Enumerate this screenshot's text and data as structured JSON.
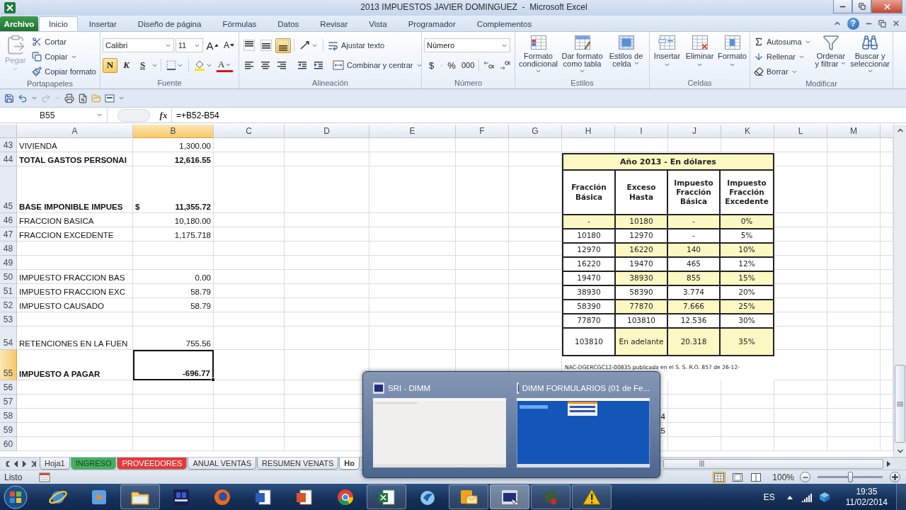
{
  "window": {
    "title": "2013 IMPUESTOS JAVIER DOMINGUEZ  -  Microsoft Excel"
  },
  "ribbon_tabs": [
    {
      "label": "Archivo",
      "kind": "file",
      "selected": false
    },
    {
      "label": "Inicio",
      "kind": "tab",
      "selected": true
    },
    {
      "label": "Insertar",
      "kind": "tab",
      "selected": false
    },
    {
      "label": "Diseño de página",
      "kind": "tab",
      "selected": false
    },
    {
      "label": "Fórmulas",
      "kind": "tab",
      "selected": false
    },
    {
      "label": "Datos",
      "kind": "tab",
      "selected": false
    },
    {
      "label": "Revisar",
      "kind": "tab",
      "selected": false
    },
    {
      "label": "Vista",
      "kind": "tab",
      "selected": false
    },
    {
      "label": "Programador",
      "kind": "tab",
      "selected": false
    },
    {
      "label": "Complementos",
      "kind": "tab",
      "selected": false
    }
  ],
  "help": "?",
  "ribbon": {
    "clipboard": {
      "label": "Portapapeles",
      "paste": {
        "label": "Pegar",
        "disabled": true
      },
      "items": [
        {
          "label": "Cortar",
          "dropdown": false
        },
        {
          "label": "Copiar",
          "dropdown": true
        },
        {
          "label": "Copiar formato",
          "dropdown": false
        }
      ]
    },
    "font": {
      "label": "Fuente",
      "font_name": "Calibri",
      "font_size": "11",
      "grow": "A",
      "shrink": "A",
      "styles": [
        {
          "label": "N",
          "selected": true
        },
        {
          "label": "K",
          "selected": false
        },
        {
          "label": "S",
          "selected": false
        }
      ],
      "color_button": "A"
    },
    "alignment": {
      "label": "Alineación",
      "vertical": [
        {
          "selected": false
        },
        {
          "selected": false
        },
        {
          "selected": true
        }
      ],
      "wrap": "Ajustar texto",
      "merge": "Combinar y centrar"
    },
    "number": {
      "label": "Número",
      "format": "Número",
      "buttons": [
        "$",
        "%",
        "000"
      ]
    },
    "styles": {
      "label": "Estilos",
      "buttons": [
        "Formato condicional",
        "Dar formato como tabla",
        "Estilos de celda"
      ]
    },
    "cells": {
      "label": "Celdas",
      "buttons": [
        "Insertar",
        "Eliminar",
        "Formato"
      ]
    },
    "editing": {
      "label": "Modificar",
      "small": [
        "Autosuma",
        "Rellenar",
        "Borrar"
      ],
      "large": [
        "Ordenar y filtrar",
        "Buscar y seleccionar"
      ]
    }
  },
  "formula_bar": {
    "name_box": "B55",
    "fx": "fx",
    "formula": "=+B52-B54"
  },
  "columns": [
    {
      "label": "A",
      "selected": false
    },
    {
      "label": "B",
      "selected": true
    },
    {
      "label": "C",
      "selected": false
    },
    {
      "label": "D",
      "selected": false
    },
    {
      "label": "E",
      "selected": false
    },
    {
      "label": "F",
      "selected": false
    },
    {
      "label": "G",
      "selected": false
    },
    {
      "label": "H",
      "selected": false
    },
    {
      "label": "I",
      "selected": false
    },
    {
      "label": "J",
      "selected": false
    },
    {
      "label": "K",
      "selected": false
    },
    {
      "label": "L",
      "selected": false
    },
    {
      "label": "M",
      "selected": false
    }
  ],
  "rows": [
    {
      "number": "43",
      "kind": "single",
      "selected": false,
      "bold": false,
      "cells": {
        "A": "VIVIENDA",
        "B": "1,300.00"
      }
    },
    {
      "number": "44",
      "kind": "single",
      "selected": false,
      "bold": true,
      "cells": {
        "A": "TOTAL GASTOS PERSONAI",
        "B": "12,616.55"
      }
    },
    {
      "number": "45",
      "kind": "triple",
      "selected": false,
      "bold": true,
      "currency": "$",
      "cells": {
        "A": "BASE IMPONIBLE IMPUES",
        "B": "11,355.72"
      }
    },
    {
      "number": "46",
      "kind": "single",
      "selected": false,
      "bold": false,
      "cells": {
        "A": "FRACCION BASICA",
        "B": "10,180.00"
      }
    },
    {
      "number": "47",
      "kind": "single",
      "selected": false,
      "bold": false,
      "cells": {
        "A": "FRACCION EXCEDENTE",
        "B": "1,175.718"
      }
    },
    {
      "number": "48",
      "kind": "single",
      "selected": false,
      "bold": false
    },
    {
      "number": "49",
      "kind": "single",
      "selected": false,
      "bold": false
    },
    {
      "number": "50",
      "kind": "single",
      "selected": false,
      "bold": false,
      "cells": {
        "A": "IMPUESTO FRACCION BAS",
        "B": "0.00"
      }
    },
    {
      "number": "51",
      "kind": "single",
      "selected": false,
      "bold": false,
      "cells": {
        "A": "IMPUESTO FRACCION EXC",
        "B": "58.79"
      }
    },
    {
      "number": "52",
      "kind": "single",
      "selected": false,
      "bold": false,
      "cells": {
        "A": "IMPUESTO CAUSADO",
        "B": "58.79"
      }
    },
    {
      "number": "53",
      "kind": "single",
      "selected": false,
      "bold": false
    },
    {
      "number": "54",
      "kind": "medium",
      "selected": false,
      "bold": false,
      "cells": {
        "A": "RETENCIONES EN LA FUEN",
        "B": "755.56"
      }
    },
    {
      "number": "55",
      "kind": "double",
      "selected": true,
      "bold": true,
      "cells": {
        "A": "IMPUESTO A PAGAR",
        "B": "-696.77"
      }
    },
    {
      "number": "56",
      "kind": "single",
      "selected": false,
      "bold": false
    },
    {
      "number": "57",
      "kind": "single",
      "selected": false,
      "bold": false
    },
    {
      "number": "58",
      "kind": "single",
      "selected": false,
      "bold": false,
      "cells": {
        "I": "4"
      }
    },
    {
      "number": "59",
      "kind": "single",
      "selected": false,
      "bold": false,
      "cells": {
        "I": "5"
      }
    },
    {
      "number": "60",
      "kind": "single",
      "selected": false,
      "bold": false
    }
  ],
  "tax_table": {
    "title": "Año 2013 - En dólares",
    "headers": [
      "Fracción Básica",
      "Exceso Hasta",
      "Impuesto Fracción Básica",
      "Impuesto Fracción Excedente"
    ],
    "rows": [
      {
        "cells": [
          {
            "text": "-",
            "shaded": true
          },
          {
            "text": "10180",
            "shaded": true
          },
          {
            "text": "-",
            "shaded": true
          },
          {
            "text": "0%",
            "shaded": true
          }
        ]
      },
      {
        "cells": [
          {
            "text": "10180",
            "shaded": false
          },
          {
            "text": "12970",
            "shaded": false
          },
          {
            "text": "-",
            "shaded": false
          },
          {
            "text": "5%",
            "shaded": false
          }
        ]
      },
      {
        "cells": [
          {
            "text": "12970",
            "shaded": false
          },
          {
            "text": "16220",
            "shaded": true
          },
          {
            "text": "140",
            "shaded": true
          },
          {
            "text": "10%",
            "shaded": true
          }
        ]
      },
      {
        "cells": [
          {
            "text": "16220",
            "shaded": false
          },
          {
            "text": "19470",
            "shaded": false
          },
          {
            "text": "465",
            "shaded": false
          },
          {
            "text": "12%",
            "shaded": false
          }
        ]
      },
      {
        "cells": [
          {
            "text": "19470",
            "shaded": false
          },
          {
            "text": "38930",
            "shaded": true
          },
          {
            "text": "855",
            "shaded": true
          },
          {
            "text": "15%",
            "shaded": true
          }
        ]
      },
      {
        "cells": [
          {
            "text": "38930",
            "shaded": false
          },
          {
            "text": "58390",
            "shaded": false
          },
          {
            "text": "3.774",
            "shaded": false
          },
          {
            "text": "20%",
            "shaded": false
          }
        ]
      },
      {
        "cells": [
          {
            "text": "58390",
            "shaded": false
          },
          {
            "text": "77870",
            "shaded": true
          },
          {
            "text": "7.666",
            "shaded": true
          },
          {
            "text": "25%",
            "shaded": true
          }
        ]
      },
      {
        "cells": [
          {
            "text": "77870",
            "shaded": false
          },
          {
            "text": "103810",
            "shaded": false
          },
          {
            "text": "12.536",
            "shaded": false
          },
          {
            "text": "30%",
            "shaded": false
          }
        ]
      },
      {
        "cells": [
          {
            "text": "103810",
            "shaded": false
          },
          {
            "text": "En adelante",
            "shaded": true
          },
          {
            "text": "20.318",
            "shaded": true
          },
          {
            "text": "35%",
            "shaded": true
          }
        ]
      }
    ]
  },
  "footnote": "NAC-DGERCGC12-00835 publicada en el S. S. R.O. 857 de 26-12-",
  "sheet_tabs": [
    {
      "label": "Hoja1",
      "selected": false
    },
    {
      "label": "INGRESO",
      "color": "#3cb35a",
      "selected": false
    },
    {
      "label": "PROVEEDORES",
      "color": "#e8383a",
      "selected": false
    },
    {
      "label": "ANUAL VENTAS",
      "selected": false
    },
    {
      "label": "RESUMEN VENATS",
      "selected": false
    },
    {
      "label": "Ho",
      "selected": true
    }
  ],
  "status_bar": {
    "text": "Listo",
    "zoom": "100%",
    "zoom_slider": {
      "level": 0.5
    }
  },
  "taskbar": {
    "items": [
      {
        "kind": "ie",
        "running": false,
        "selected": false
      },
      {
        "kind": "media",
        "running": false,
        "selected": false
      },
      {
        "kind": "explorer",
        "running": true,
        "selected": false
      },
      {
        "kind": "concar",
        "running": false,
        "selected": false
      },
      {
        "kind": "firefox",
        "running": false,
        "selected": false
      },
      {
        "kind": "word",
        "running": false,
        "selected": false
      },
      {
        "kind": "powerpoint",
        "running": false,
        "selected": false
      },
      {
        "kind": "chrome",
        "running": false,
        "selected": false
      },
      {
        "kind": "excel",
        "running": true,
        "selected": false
      },
      {
        "kind": "bird",
        "running": false,
        "selected": false
      },
      {
        "kind": "outlook",
        "running": true,
        "selected": false
      },
      {
        "kind": "sri",
        "running": true,
        "selected": true
      },
      {
        "kind": "snip",
        "running": true,
        "selected": false
      },
      {
        "kind": "warning",
        "running": true,
        "selected": false
      }
    ],
    "language": "ES",
    "time": "19:35",
    "date": "11/02/2014"
  },
  "preview": {
    "windows": [
      {
        "title": "SRI - DIMM"
      },
      {
        "title": "DIMM FORMULARIOS (01 de Fe..."
      }
    ]
  }
}
